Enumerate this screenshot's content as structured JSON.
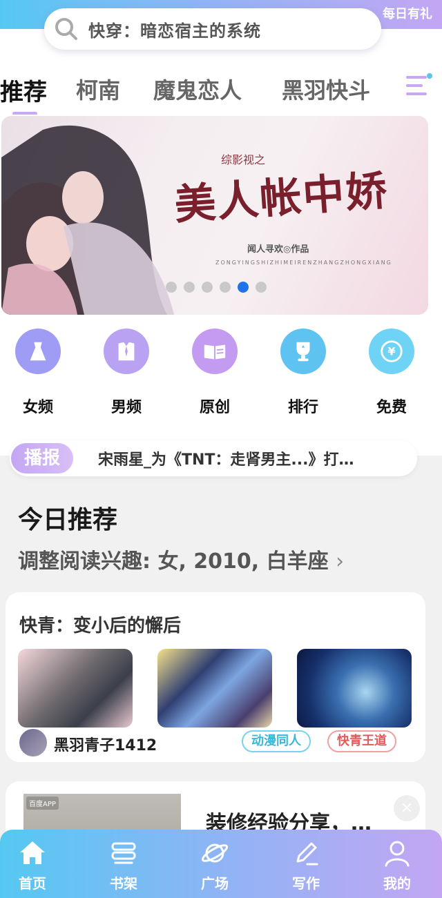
{
  "header": {
    "gift_label": "每日有礼",
    "search": {
      "icon": "search-icon",
      "text": "快穿：暗恋宿主的系统"
    }
  },
  "tabs": [
    {
      "label": "推荐",
      "active": true
    },
    {
      "label": "柯南"
    },
    {
      "label": "魔鬼恋人"
    },
    {
      "label": "黑羽快斗"
    }
  ],
  "banner": {
    "subtitle": "综影视之",
    "title": "美人帐中娇",
    "author": "闻人寻欢◎作品",
    "pinyin": "ZONGYINGSHIZHIMEIRENZHANGZHONGXIANG",
    "slide_count": 6,
    "active_slide": 5
  },
  "categories": [
    {
      "label": "女频",
      "icon": "dress-icon",
      "color": "#9f9cf5"
    },
    {
      "label": "男频",
      "icon": "shirt-icon",
      "color": "#b9a2f2"
    },
    {
      "label": "原创",
      "icon": "book-icon",
      "color": "#c39cf2"
    },
    {
      "label": "排行",
      "icon": "trophy-icon",
      "color": "#5ec3f0"
    },
    {
      "label": "免费",
      "icon": "yen-icon",
      "color": "#6fd3f5"
    }
  ],
  "broadcast": {
    "tag": "播报",
    "text": "宋雨星_为《TNT：走肾男主...》打…"
  },
  "today": {
    "title": "今日推荐",
    "subtitle": "调整阅读兴趣: 女, 2010, 白羊座",
    "chevron": "›"
  },
  "card": {
    "title": "快青：变小后的懈后",
    "user": "黑羽青子1412",
    "tags": [
      "动漫同人",
      "快青王道"
    ]
  },
  "card2": {
    "logo": "百度APP",
    "title": "装修经验分享，…",
    "close": "×"
  },
  "bottom_nav": [
    {
      "label": "首页",
      "icon": "home-icon"
    },
    {
      "label": "书架",
      "icon": "bookshelf-icon"
    },
    {
      "label": "广场",
      "icon": "planet-icon"
    },
    {
      "label": "写作",
      "icon": "pen-icon"
    },
    {
      "label": "我的",
      "icon": "user-icon"
    }
  ],
  "colors": {
    "accent_gradient_start": "#55c8f2",
    "accent_gradient_end": "#c3a6f3",
    "active_dot": "#1e73e8"
  }
}
